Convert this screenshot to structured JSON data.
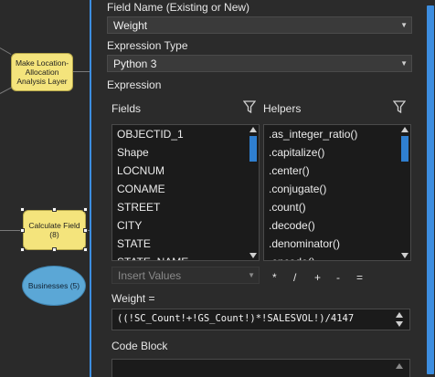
{
  "canvas": {
    "nodes": [
      {
        "label": "Make Location-Allocation Analysis Layer"
      },
      {
        "label": "Calculate Field (8)"
      },
      {
        "label": "Businesses (5)"
      }
    ]
  },
  "panel": {
    "field_name_label": "Field Name (Existing or New)",
    "field_name_value": "Weight",
    "expression_type_label": "Expression Type",
    "expression_type_value": "Python 3",
    "expression_label": "Expression",
    "fields_label": "Fields",
    "helpers_label": "Helpers",
    "fields": [
      "OBJECTID_1",
      "Shape",
      "LOCNUM",
      "CONAME",
      "STREET",
      "CITY",
      "STATE",
      "STATE_NAME"
    ],
    "helpers": [
      ".as_integer_ratio()",
      ".capitalize()",
      ".center()",
      ".conjugate()",
      ".count()",
      ".decode()",
      ".denominator()",
      ".encode()"
    ],
    "insert_values_placeholder": "Insert Values",
    "operators": [
      "*",
      "/",
      "+",
      "-",
      "="
    ],
    "weight_expr_label": "Weight =",
    "expression_value": "((!SC_Count!+!GS_Count!)*!SALESVOL!)/4147",
    "code_block_label": "Code Block"
  },
  "icons": {
    "filter": "filter-icon",
    "dropdown": "chevron-down-icon"
  },
  "colors": {
    "accent": "#3d8ee0",
    "node_yellow": "#f4e47c",
    "node_blue": "#5ba7d6",
    "panel_bg": "#2b2b2b"
  }
}
